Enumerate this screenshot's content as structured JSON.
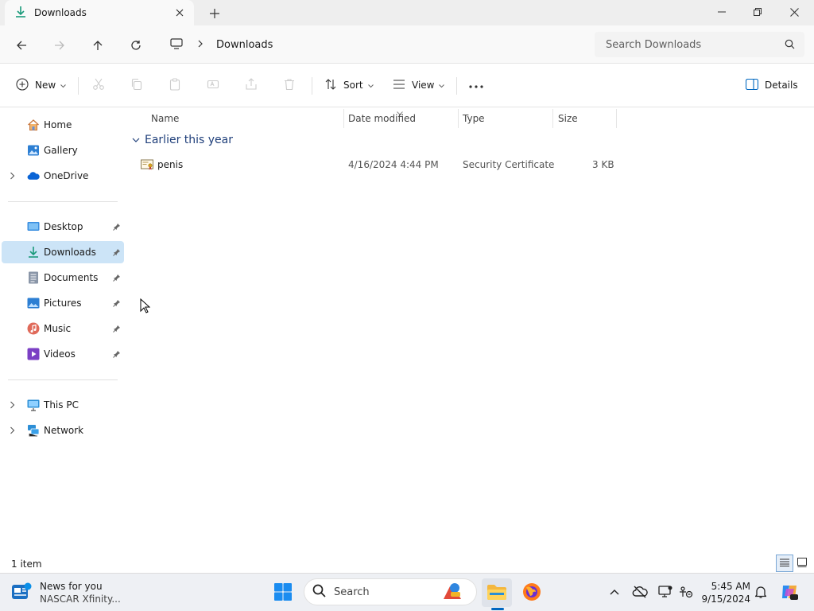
{
  "window": {
    "tab_title": "Downloads",
    "colors": {
      "accent": "#0067c0",
      "selected": "#cce4f7",
      "group": "#1f3f7a"
    }
  },
  "titlebar": {
    "icons": {
      "tab": "download-icon",
      "close_tab": "close-icon",
      "new_tab": "plus-icon",
      "minimize": "minimize-icon",
      "restore": "restore-icon",
      "close": "close-icon"
    }
  },
  "nav": {
    "breadcrumb": [
      "Downloads"
    ],
    "search_placeholder": "Search Downloads",
    "icons": [
      "back-icon",
      "forward-icon",
      "up-icon",
      "refresh-icon",
      "monitor-icon",
      "chevron-right-icon",
      "search-icon"
    ]
  },
  "toolbar": {
    "new_label": "New",
    "sort_label": "Sort",
    "view_label": "View",
    "details_label": "Details",
    "icons": [
      "plus-circle-icon",
      "cut-icon",
      "copy-icon",
      "paste-icon",
      "rename-icon",
      "share-icon",
      "delete-icon",
      "sort-icon",
      "view-icon",
      "more-icon",
      "details-pane-icon"
    ]
  },
  "sidebar": {
    "top_items": [
      {
        "label": "Home",
        "icon": "home-icon"
      },
      {
        "label": "Gallery",
        "icon": "gallery-icon"
      },
      {
        "label": "OneDrive",
        "icon": "cloud-icon"
      }
    ],
    "quick_access": [
      {
        "label": "Desktop",
        "icon": "desktop-icon"
      },
      {
        "label": "Downloads",
        "icon": "download-icon",
        "selected": true
      },
      {
        "label": "Documents",
        "icon": "documents-icon"
      },
      {
        "label": "Pictures",
        "icon": "pictures-icon"
      },
      {
        "label": "Music",
        "icon": "music-icon"
      },
      {
        "label": "Videos",
        "icon": "videos-icon"
      }
    ],
    "bottom_items": [
      {
        "label": "This PC",
        "icon": "pc-icon"
      },
      {
        "label": "Network",
        "icon": "network-icon"
      }
    ]
  },
  "content": {
    "columns": [
      "Name",
      "Date modified",
      "Type",
      "Size"
    ],
    "group_label": "Earlier this year",
    "files": [
      {
        "name": "penis",
        "date_modified": "4/16/2024 4:44 PM",
        "type": "Security Certificate",
        "size": "3 KB",
        "icon": "certificate-icon"
      }
    ]
  },
  "status": {
    "item_count": "1 item",
    "icons": [
      "details-view-icon",
      "tiles-view-icon"
    ]
  },
  "taskbar": {
    "news_title": "News for you",
    "news_subtitle": "NASCAR Xfinity...",
    "search_label": "Search",
    "time": "5:45 AM",
    "date": "9/15/2024",
    "icons": [
      "news-icon",
      "windows-start-icon",
      "search-icon",
      "copilot-badge-icon",
      "file-explorer-icon",
      "firefox-icon",
      "chevron-up-icon",
      "onedrive-offline-icon",
      "display-icon",
      "accessibility-icon",
      "bell-icon",
      "copilot-icon"
    ]
  }
}
